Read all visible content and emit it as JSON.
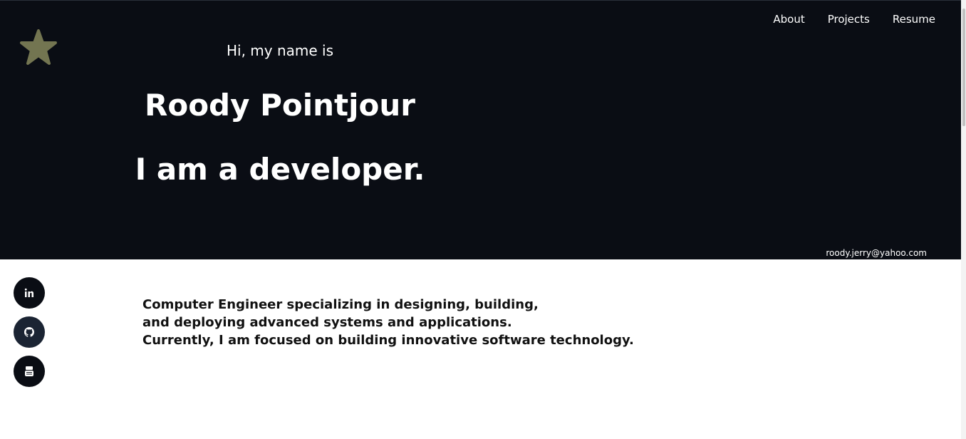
{
  "nav": {
    "items": [
      "About",
      "Projects",
      "Resume"
    ]
  },
  "hero": {
    "intro": "Hi, my name is",
    "name": "Roody Pointjour",
    "role": "I am a developer.",
    "email": "roody.jerry@yahoo.com",
    "background_color": "#0a0d14",
    "star_color": "#737551"
  },
  "about": {
    "lines": [
      "Computer Engineer specializing in designing, building,",
      "and deploying advanced systems and applications.",
      "Currently, I am focused on building innovative software technology."
    ]
  },
  "social": {
    "icons": [
      "linkedin-icon",
      "github-icon",
      "youtube-icon"
    ]
  }
}
